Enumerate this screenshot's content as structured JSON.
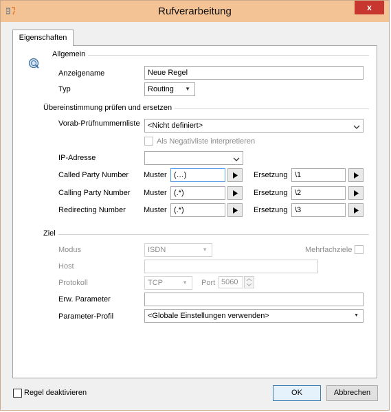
{
  "window": {
    "title": "Rufverarbeitung",
    "close_label": "x"
  },
  "tab": {
    "label": "Eigenschaften"
  },
  "general": {
    "heading": "Allgemein",
    "name_label": "Anzeigename",
    "name_value": "Neue Regel",
    "type_label": "Typ",
    "type_value": "Routing"
  },
  "match": {
    "heading": "Übereinstimmung prüfen und ersetzen",
    "prefix_list_label": "Vorab-Prüfnummernliste",
    "prefix_list_value": "<Nicht definiert>",
    "negative_label": "Als Negativliste interpretieren",
    "ip_label": "IP-Adresse",
    "ip_value": "",
    "pattern_label": "Muster",
    "replace_label": "Ersetzung",
    "rows": [
      {
        "label": "Called Party Number",
        "pattern": "(…)",
        "replacement": "\\1"
      },
      {
        "label": "Calling Party Number",
        "pattern": "(.*)",
        "replacement": "\\2"
      },
      {
        "label": "Redirecting Number",
        "pattern": "(.*)",
        "replacement": "\\3"
      }
    ]
  },
  "target": {
    "heading": "Ziel",
    "mode_label": "Modus",
    "mode_value": "ISDN",
    "multi_label": "Mehrfachziele",
    "host_label": "Host",
    "host_value": "",
    "protocol_label": "Protokoll",
    "protocol_value": "TCP",
    "port_label": "Port",
    "port_value": "5060",
    "ext_params_label": "Erw. Parameter",
    "ext_params_value": "",
    "param_profile_label": "Parameter-Profil",
    "param_profile_value": "<Globale Einstellungen verwenden>"
  },
  "footer": {
    "disable_label": "Regel deaktivieren",
    "ok_label": "OK",
    "cancel_label": "Abbrechen"
  },
  "colors": {
    "titlebar": "#f3c396",
    "close_button": "#c7372f",
    "focus_border": "#569de5"
  }
}
